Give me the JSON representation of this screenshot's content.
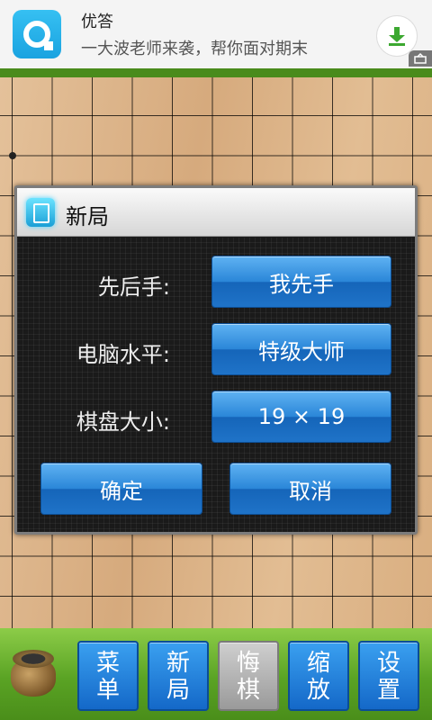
{
  "ad": {
    "title": "优答",
    "subtitle": "一大波老师来袭，帮你面对期末",
    "download_icon": "download-arrow-icon",
    "corner_icon": "ad-badge-icon"
  },
  "dialog": {
    "title": "新局",
    "icon": "new-game-icon",
    "rows": [
      {
        "label": "先后手:",
        "value": "我先手"
      },
      {
        "label": "电脑水平:",
        "value": "特级大师"
      },
      {
        "label": "棋盘大小:",
        "value": "19 × 19"
      }
    ],
    "confirm": "确定",
    "cancel": "取消"
  },
  "toolbar": {
    "pot_icon": "go-stone-pot-icon",
    "buttons": [
      {
        "top": "菜",
        "bottom": "单"
      },
      {
        "top": "新",
        "bottom": "局"
      },
      {
        "top": "悔",
        "bottom": "棋"
      },
      {
        "top": "缩",
        "bottom": "放"
      },
      {
        "top": "设",
        "bottom": "置"
      }
    ]
  },
  "colors": {
    "board": "#ddb58a",
    "accent_blue": "#2a86d8",
    "toolbar_green": "#5aa324",
    "disabled_gray": "#9a9a9a"
  }
}
